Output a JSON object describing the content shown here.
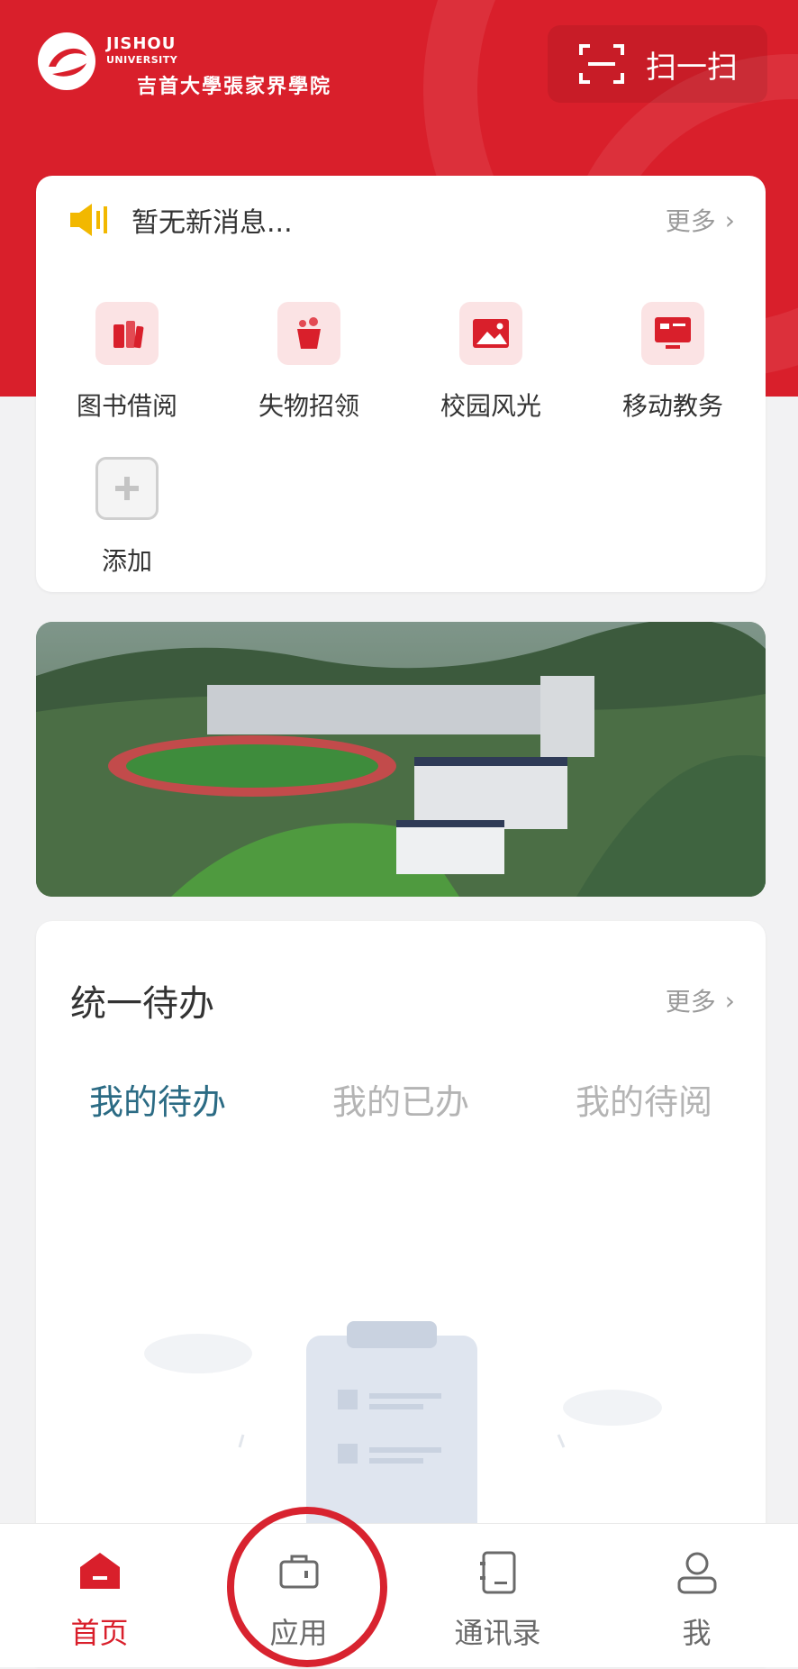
{
  "header": {
    "logo_line1": "JISHOU",
    "logo_line2": "UNIVERSITY",
    "logo_cn": "吉首大學張家界學院",
    "scan_label": "扫一扫"
  },
  "notice": {
    "text": "暂无新消息...",
    "more_label": "更多"
  },
  "quick_apps": [
    {
      "label": "图书借阅",
      "icon": "book-icon"
    },
    {
      "label": "失物招领",
      "icon": "lost-found-icon"
    },
    {
      "label": "校园风光",
      "icon": "image-icon"
    },
    {
      "label": "移动教务",
      "icon": "screen-icon"
    },
    {
      "label": "添加",
      "icon": "plus-icon"
    }
  ],
  "todo": {
    "title": "统一待办",
    "more_label": "更多",
    "tabs": [
      {
        "label": "我的待办",
        "active": true
      },
      {
        "label": "我的已办",
        "active": false
      },
      {
        "label": "我的待阅",
        "active": false
      }
    ]
  },
  "bottom_nav": [
    {
      "label": "首页",
      "icon": "home-icon",
      "active": true
    },
    {
      "label": "应用",
      "icon": "briefcase-icon",
      "active": false
    },
    {
      "label": "通讯录",
      "icon": "contacts-icon",
      "active": false
    },
    {
      "label": "我",
      "icon": "user-icon",
      "active": false
    }
  ],
  "colors": {
    "brand_red": "#d91f2b",
    "active_tab": "#2b6b84",
    "icon_tint_bg": "#fbe3e4"
  }
}
